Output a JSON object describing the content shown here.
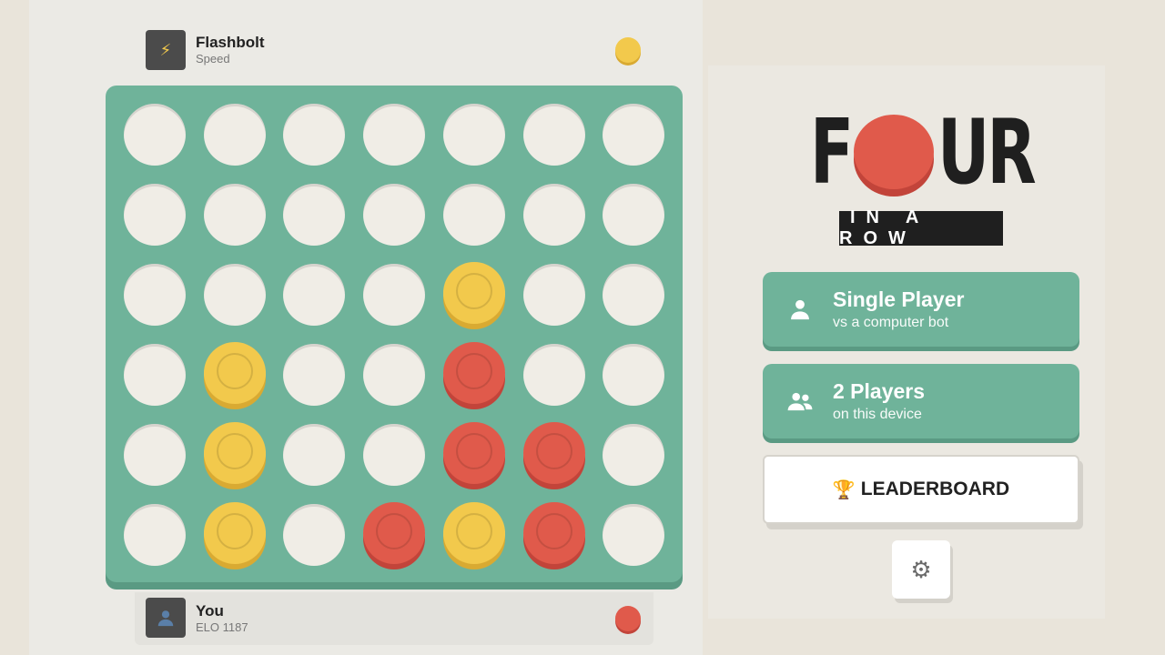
{
  "opponent": {
    "name": "Flashbolt",
    "subtitle": "Speed",
    "avatar_icon": "lightning-icon",
    "chip_color": "#f2c94c"
  },
  "player": {
    "name": "You",
    "subtitle": "ELO 1187",
    "avatar_icon": "person-icon",
    "chip_color": "#e05a4b"
  },
  "board": {
    "columns": 7,
    "rows": 6,
    "grid": [
      [
        ".",
        ".",
        ".",
        ".",
        ".",
        ".",
        "."
      ],
      [
        ".",
        ".",
        ".",
        ".",
        ".",
        ".",
        "."
      ],
      [
        ".",
        ".",
        ".",
        ".",
        "Y",
        ".",
        "."
      ],
      [
        ".",
        "Y",
        ".",
        ".",
        "R",
        ".",
        "."
      ],
      [
        ".",
        "Y",
        ".",
        ".",
        "R",
        "R",
        "."
      ],
      [
        ".",
        "Y",
        ".",
        "R",
        "Y",
        "R",
        "."
      ]
    ],
    "colors": {
      "board": "#6fb39a",
      "empty": "#f0ede6",
      "yellow": "#f2c94c",
      "red": "#e05a4b"
    }
  },
  "logo": {
    "letter_f": "F",
    "letter_ur": "UR",
    "subtitle": "IN A ROW"
  },
  "menu": {
    "single_player": {
      "title": "Single Player",
      "subtitle": "vs a computer bot"
    },
    "two_players": {
      "title": "2 Players",
      "subtitle": "on this device"
    },
    "leaderboard": {
      "icon": "🏆",
      "label": "LEADERBOARD"
    },
    "settings": {
      "icon": "⚙"
    }
  }
}
